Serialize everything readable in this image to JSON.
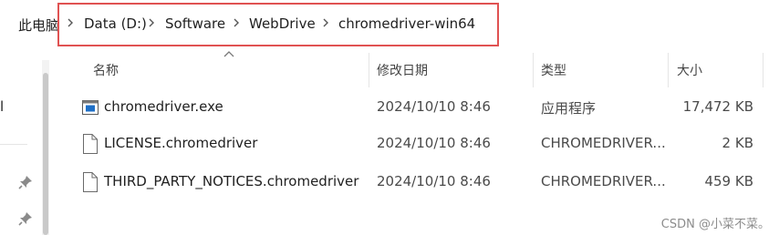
{
  "address_bar": {
    "root_label": "此电脑",
    "path": [
      "Data (D:)",
      "Software",
      "WebDrive",
      "chromedriver-win64"
    ]
  },
  "navigation_pane": {
    "cut_off_text": "l",
    "pinned_icons": [
      "pin-icon",
      "pin-icon"
    ]
  },
  "columns": {
    "name": "名称",
    "modified": "修改日期",
    "type": "类型",
    "size": "大小",
    "sort_indicator": "chevron-up-icon"
  },
  "files": [
    {
      "name": "chromedriver.exe",
      "modified": "2024/10/10 8:46",
      "type": "应用程序",
      "size": "17,472 KB",
      "icon": "executable-icon"
    },
    {
      "name": "LICENSE.chromedriver",
      "modified": "2024/10/10 8:46",
      "type": "CHROMEDRIVER...",
      "size": "2 KB",
      "icon": "file-icon"
    },
    {
      "name": "THIRD_PARTY_NOTICES.chromedriver",
      "modified": "2024/10/10 8:46",
      "type": "CHROMEDRIVER...",
      "size": "459 KB",
      "icon": "file-icon"
    }
  ],
  "watermark": "CSDN @小菜不菜。",
  "colors": {
    "highlight_border": "#e05252",
    "exe_icon": "#1e6fc7"
  }
}
